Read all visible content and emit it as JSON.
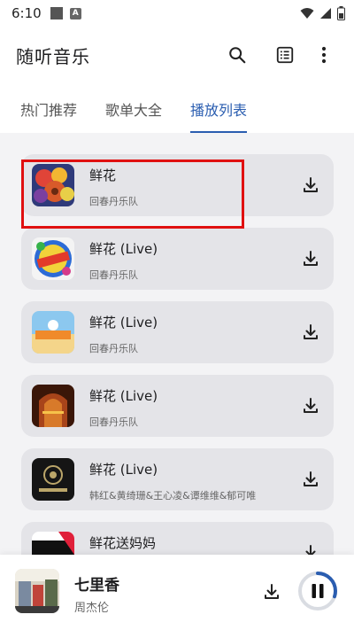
{
  "status_bar": {
    "time": "6:10",
    "icons": [
      "square-icon",
      "a-icon",
      "wifi-icon",
      "signal-icon",
      "battery-icon"
    ]
  },
  "app_bar": {
    "title": "随听音乐",
    "actions": [
      "search-icon",
      "list-icon",
      "more-vert-icon"
    ]
  },
  "tabs": [
    {
      "label": "热门推荐",
      "active": false
    },
    {
      "label": "歌单大全",
      "active": false
    },
    {
      "label": "播放列表",
      "active": true
    }
  ],
  "songs": [
    {
      "title": "鲜花",
      "artist": "回春丹乐队"
    },
    {
      "title": "鲜花 (Live)",
      "artist": "回春丹乐队"
    },
    {
      "title": "鲜花 (Live)",
      "artist": "回春丹乐队"
    },
    {
      "title": "鲜花 (Live)",
      "artist": "回春丹乐队"
    },
    {
      "title": "鲜花 (Live)",
      "artist": "韩红&黄绮珊&王心凌&谭维维&郁可唯"
    },
    {
      "title": "鲜花送妈妈",
      "artist": ""
    }
  ],
  "now_playing": {
    "title": "七里香",
    "artist": "周杰伦",
    "progress": 0.3
  },
  "colors": {
    "accent": "#2a5db0",
    "highlight": "#e01010",
    "card": "#e4e4e8",
    "list_bg": "#f3f3f5"
  }
}
